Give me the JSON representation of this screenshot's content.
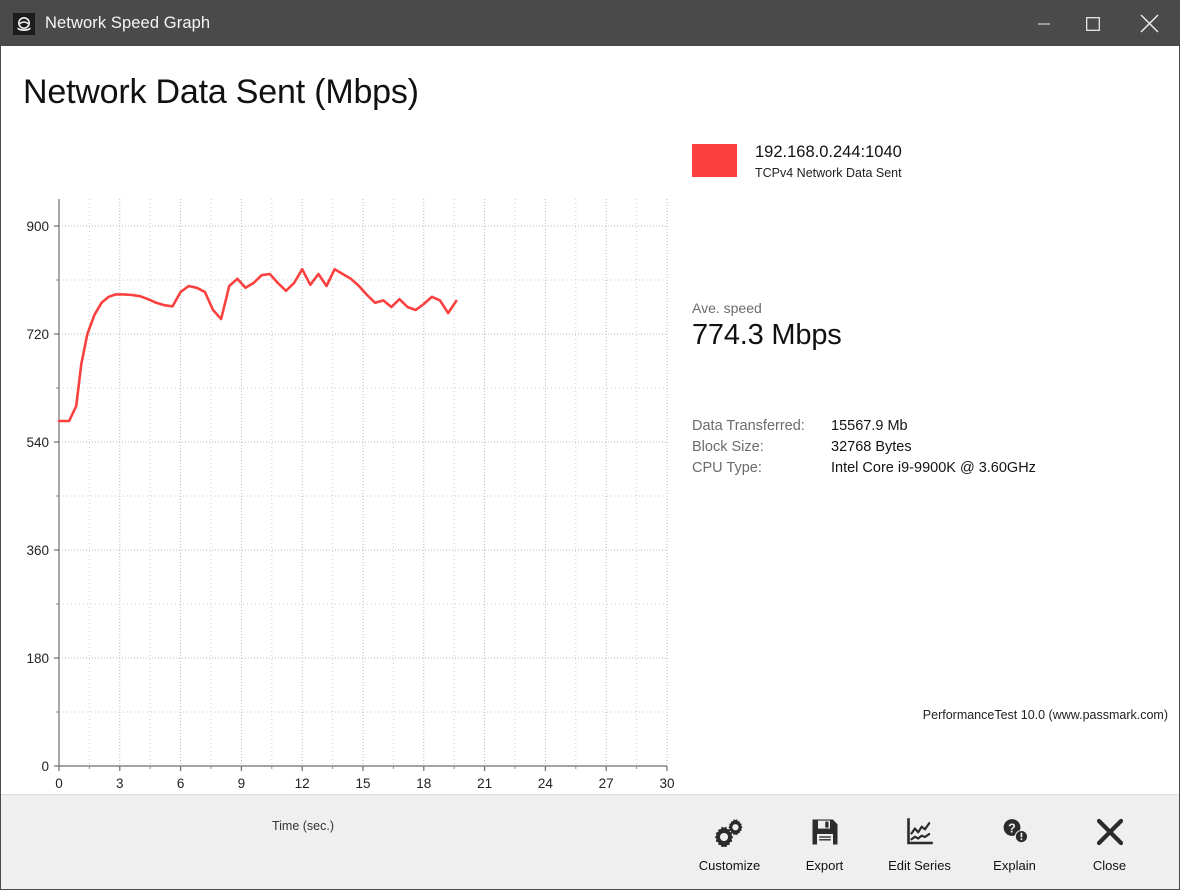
{
  "window": {
    "title": "Network Speed Graph",
    "icon": "app-logo-icon",
    "minimize_label": "Minimize",
    "maximize_label": "Maximize",
    "close_label": "Close"
  },
  "page_title": "Network Data Sent (Mbps)",
  "legend": {
    "swatch_color": "#fb4040",
    "title": "192.168.0.244:1040",
    "subtitle": "TCPv4 Network Data Sent"
  },
  "average": {
    "label": "Ave. speed",
    "value": "774.3 Mbps"
  },
  "stats": [
    {
      "key": "Data Transferred:",
      "value": "15567.9 Mb"
    },
    {
      "key": "Block Size:",
      "value": "32768 Bytes"
    },
    {
      "key": "CPU Type:",
      "value": "Intel Core i9-9900K @ 3.60GHz"
    }
  ],
  "footer_note": "PerformanceTest 10.0 (www.passmark.com)",
  "toolbar": {
    "buttons": [
      {
        "label": "Customize",
        "icon": "gears-icon"
      },
      {
        "label": "Export",
        "icon": "floppy-disk-icon"
      },
      {
        "label": "Edit Series",
        "icon": "line-chart-icon"
      },
      {
        "label": "Explain",
        "icon": "question-info-icon"
      },
      {
        "label": "Close",
        "icon": "close-x-icon"
      }
    ]
  },
  "chart_data": {
    "type": "line",
    "title": "Network Data Sent (Mbps)",
    "xlabel": "Time (sec.)",
    "ylabel": "",
    "xlim": [
      0,
      30
    ],
    "ylim": [
      0,
      945
    ],
    "xticks": [
      0,
      3,
      6,
      9,
      12,
      15,
      18,
      21,
      24,
      27,
      30
    ],
    "yticks": [
      0,
      180,
      360,
      540,
      720,
      900
    ],
    "minor_y_step": 90,
    "minor_x_step": 1.5,
    "grid": true,
    "legend_position": "right",
    "line_color": "#fb4040",
    "line_width": 2.6,
    "series": [
      {
        "name": "192.168.0.244:1040 TCPv4 Network Data Sent",
        "x": [
          0.0,
          0.5,
          0.85,
          1.1,
          1.4,
          1.75,
          2.1,
          2.45,
          2.8,
          3.2,
          3.6,
          4.0,
          4.4,
          4.8,
          5.2,
          5.6,
          6.0,
          6.4,
          6.8,
          7.2,
          7.6,
          8.0,
          8.4,
          8.8,
          9.2,
          9.6,
          10.0,
          10.4,
          10.8,
          11.2,
          11.6,
          12.0,
          12.4,
          12.8,
          13.2,
          13.6,
          14.0,
          14.4,
          14.8,
          15.2,
          15.6,
          16.0,
          16.4,
          16.8,
          17.2,
          17.6,
          18.0,
          18.4,
          18.8,
          19.2,
          19.6
        ],
        "y": [
          575,
          575,
          600,
          670,
          720,
          752,
          772,
          782,
          786,
          786,
          785,
          783,
          778,
          772,
          768,
          766,
          790,
          800,
          797,
          790,
          760,
          745,
          800,
          812,
          797,
          805,
          818,
          820,
          805,
          792,
          805,
          828,
          802,
          820,
          800,
          828,
          820,
          812,
          800,
          785,
          772,
          776,
          765,
          778,
          765,
          760,
          770,
          782,
          776,
          755,
          775
        ]
      }
    ]
  }
}
